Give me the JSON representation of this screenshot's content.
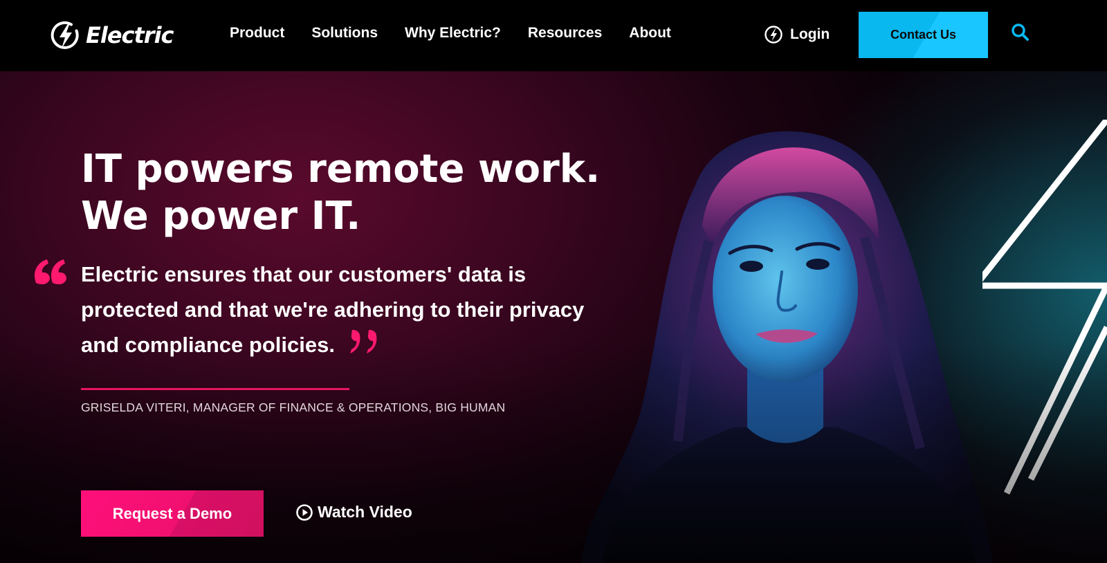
{
  "nav": {
    "brand": "Electric",
    "links": [
      {
        "label": "Product"
      },
      {
        "label": "Solutions"
      },
      {
        "label": "Why Electric?"
      },
      {
        "label": "Resources"
      },
      {
        "label": "About"
      }
    ],
    "login_label": "Login",
    "contact_label": "Contact Us"
  },
  "hero": {
    "headline_line1": "IT powers remote work.",
    "headline_line2": "We power IT.",
    "quote": "Electric ensures that our customers' data is protected and that we're adhering to their privacy and compliance policies.",
    "attribution": "GRISELDA VITERI, MANAGER OF FINANCE & OPERATIONS, BIG HUMAN",
    "cta_primary": "Request a Demo",
    "cta_secondary": "Watch Video"
  },
  "icons": {
    "logo": "lightning-bolt-circle-icon",
    "login": "lightning-bolt-circle-icon",
    "search": "search-icon",
    "quote_open": "open-quote-icon",
    "quote_close": "close-quote-icon",
    "play": "play-circle-icon",
    "background": "lightning-bolt-outline"
  },
  "colors": {
    "nav_background": "#000000",
    "accent_cyan": "#0ab8f0",
    "accent_pink": "#e8155e",
    "cta_pink": "#ff0f7b",
    "hero_background": "#3a0620"
  }
}
